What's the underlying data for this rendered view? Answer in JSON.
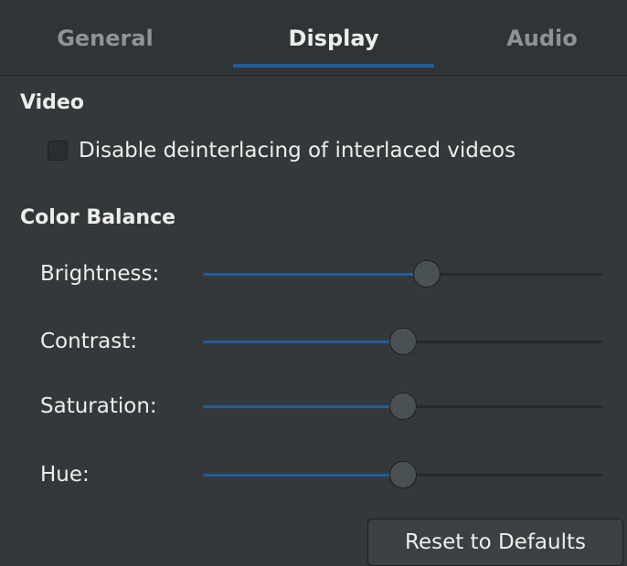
{
  "tabs": [
    {
      "label": "General",
      "active": false
    },
    {
      "label": "Display",
      "active": true
    },
    {
      "label": "Audio",
      "active": false
    }
  ],
  "video": {
    "title": "Video",
    "deinterlace_label": "Disable deinterlacing of interlaced videos",
    "deinterlace_checked": false
  },
  "color_balance": {
    "title": "Color Balance",
    "sliders": [
      {
        "label": "Brightness:",
        "fraction": 0.56
      },
      {
        "label": "Contrast:",
        "fraction": 0.5
      },
      {
        "label": "Saturation:",
        "fraction": 0.5
      },
      {
        "label": "Hue:",
        "fraction": 0.5
      }
    ]
  },
  "reset_label": "Reset to Defaults",
  "colors": {
    "accent": "#215d9c",
    "background": "#33393b",
    "text": "#eeeeec"
  }
}
